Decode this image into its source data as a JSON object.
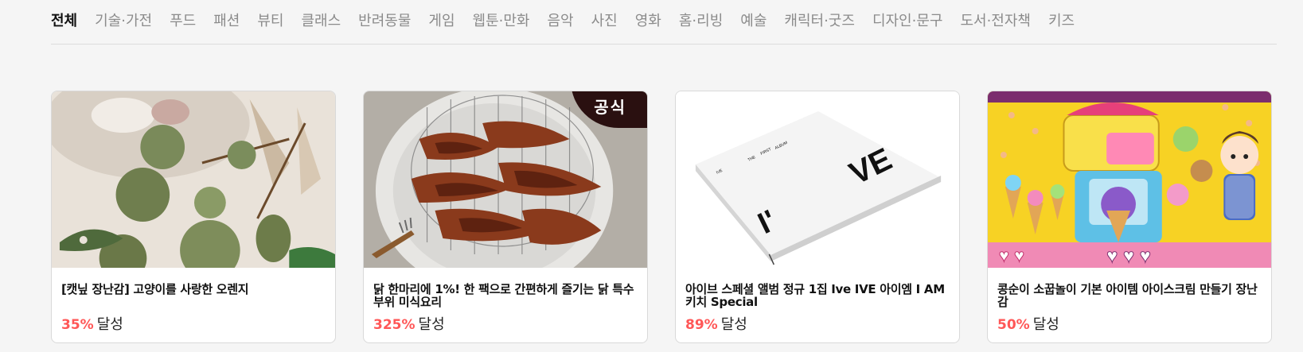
{
  "tabs": [
    {
      "label": "전체",
      "active": true
    },
    {
      "label": "기술·가전"
    },
    {
      "label": "푸드"
    },
    {
      "label": "패션"
    },
    {
      "label": "뷰티"
    },
    {
      "label": "클래스"
    },
    {
      "label": "반려동물"
    },
    {
      "label": "게임"
    },
    {
      "label": "웹툰·만화"
    },
    {
      "label": "음악"
    },
    {
      "label": "사진"
    },
    {
      "label": "영화"
    },
    {
      "label": "홈·리빙"
    },
    {
      "label": "예술"
    },
    {
      "label": "캐릭터·굿즈"
    },
    {
      "label": "디자인·문구"
    },
    {
      "label": "도서·전자책"
    },
    {
      "label": "키즈"
    }
  ],
  "cards": [
    {
      "title": "[캣닢 장난감] 고양이를 사랑한 오렌지",
      "percent": "35%",
      "achieved_label": "달성",
      "image": "cat-catnip-toys"
    },
    {
      "title": "닭 한마리에 1%! 한 팩으로 간편하게 즐기는 닭 특수부위 미식요리",
      "percent": "325%",
      "achieved_label": "달성",
      "image": "grilled-chicken-dish",
      "badge": "공식"
    },
    {
      "title": "아이브 스페셜 앨범 정규 1집 Ive IVE 아이엠 I AM 키치 Special",
      "percent": "89%",
      "achieved_label": "달성",
      "image": "ive-album",
      "album_text": {
        "big_left": "I'",
        "big_right": "VE",
        "small_1": "IVE",
        "small_2": "THE",
        "small_3": "FIRST",
        "small_4": "ALBUM"
      }
    },
    {
      "title": "콩순이 소꿉놀이 기본 아이템 아이스크림 만들기 장난감",
      "percent": "50%",
      "achieved_label": "달성",
      "image": "toy-ice-cream-set"
    }
  ],
  "colors": {
    "accent": "#ff5757",
    "active_tab": "#111111",
    "inactive_tab": "#8b8b8b"
  }
}
